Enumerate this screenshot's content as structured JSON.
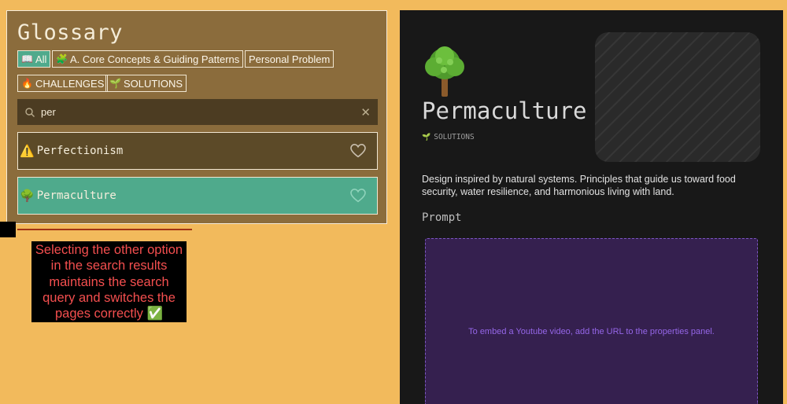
{
  "glossary": {
    "title": "Glossary",
    "filters": [
      {
        "icon": "📖",
        "label": "All",
        "active": true
      },
      {
        "icon": "🧩",
        "label": "A. Core Concepts & Guiding Patterns",
        "active": false
      },
      {
        "icon": "",
        "label": "Personal Problem",
        "active": false
      },
      {
        "icon": "🔥",
        "label": "CHALLENGES",
        "active": false
      },
      {
        "icon": "🌱",
        "label": "SOLUTIONS",
        "active": false
      }
    ],
    "search": {
      "value": "per",
      "placeholder": ""
    },
    "results": [
      {
        "icon": "⚠️",
        "label": "Perfectionism",
        "selected": false
      },
      {
        "icon": "🌳",
        "label": "Permaculture",
        "selected": true
      }
    ]
  },
  "annotation": {
    "text": "Selecting the other option in the search results maintains the search query and switches the pages correctly ✅"
  },
  "detail": {
    "icon": "🌳",
    "title": "Permaculture",
    "tag_icon": "🌱",
    "tag": "SOLUTIONS",
    "description": "Design inspired by natural systems. Principles that guide us toward food security, water resilience, and harmonious living with land.",
    "prompt_heading": "Prompt",
    "embed_message": "To embed a Youtube video, add the URL to the properties panel."
  },
  "colors": {
    "page_background": "#f2ba5c",
    "glossary_panel": "#8b6c3c",
    "active_teal": "#4faa8c",
    "detail_background": "#181818",
    "embed_background": "#35204f",
    "annotation_text": "#f44f4f"
  }
}
